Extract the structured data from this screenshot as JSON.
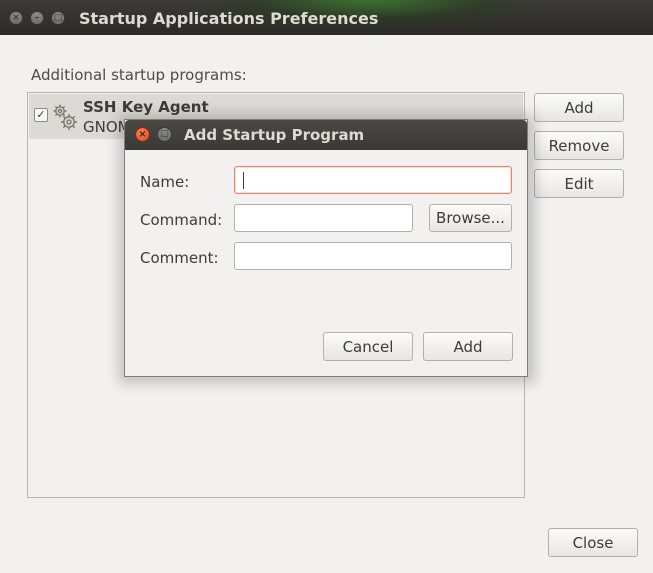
{
  "window": {
    "title": "Startup Applications Preferences",
    "controls": {
      "close": "×",
      "minimize": "–",
      "maximize": "□"
    }
  },
  "main": {
    "section_label": "Additional startup programs:",
    "items": [
      {
        "title": "SSH Key Agent",
        "subtitle": "GNOME",
        "checked": true,
        "icon": "gears-icon"
      }
    ],
    "buttons": {
      "add": "Add",
      "remove": "Remove",
      "edit": "Edit"
    },
    "close_button": "Close"
  },
  "dialog": {
    "title": "Add Startup Program",
    "fields": {
      "name_label": "Name:",
      "name_value": "",
      "command_label": "Command:",
      "command_value": "",
      "comment_label": "Comment:",
      "comment_value": ""
    },
    "browse_button": "Browse...",
    "cancel_button": "Cancel",
    "add_button": "Add"
  },
  "colors": {
    "titlebar": "#3c3b37",
    "window_bg": "#f2f1f0",
    "close_button_accent": "#e1461c",
    "focus_border": "#e9836a"
  }
}
